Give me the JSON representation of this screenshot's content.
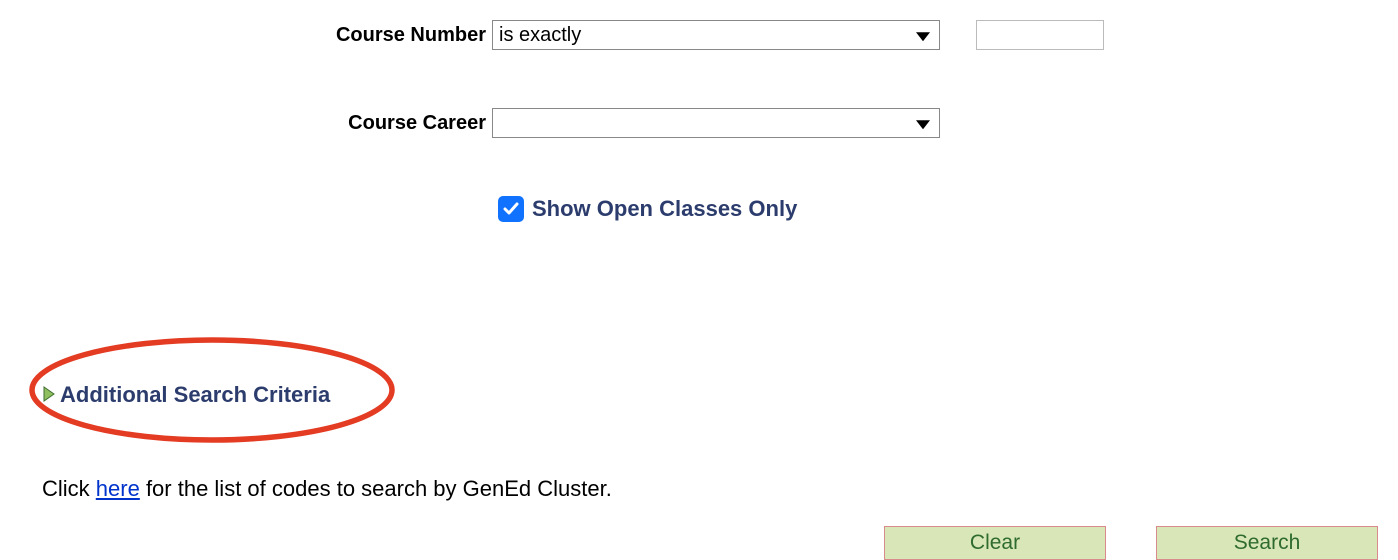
{
  "form": {
    "course_number_label": "Course Number",
    "course_number_operator": "is exactly",
    "course_number_value": "",
    "course_career_label": "Course Career",
    "course_career_value": ""
  },
  "checkbox": {
    "show_open_label": "Show Open Classes Only",
    "checked": true
  },
  "additional": {
    "label": "Additional Search Criteria"
  },
  "help": {
    "prefix": "Click ",
    "link_text": "here",
    "suffix": " for the list of codes to search by GenEd Cluster."
  },
  "buttons": {
    "clear": "Clear",
    "search": "Search"
  },
  "colors": {
    "annotation": "#e43b23"
  }
}
